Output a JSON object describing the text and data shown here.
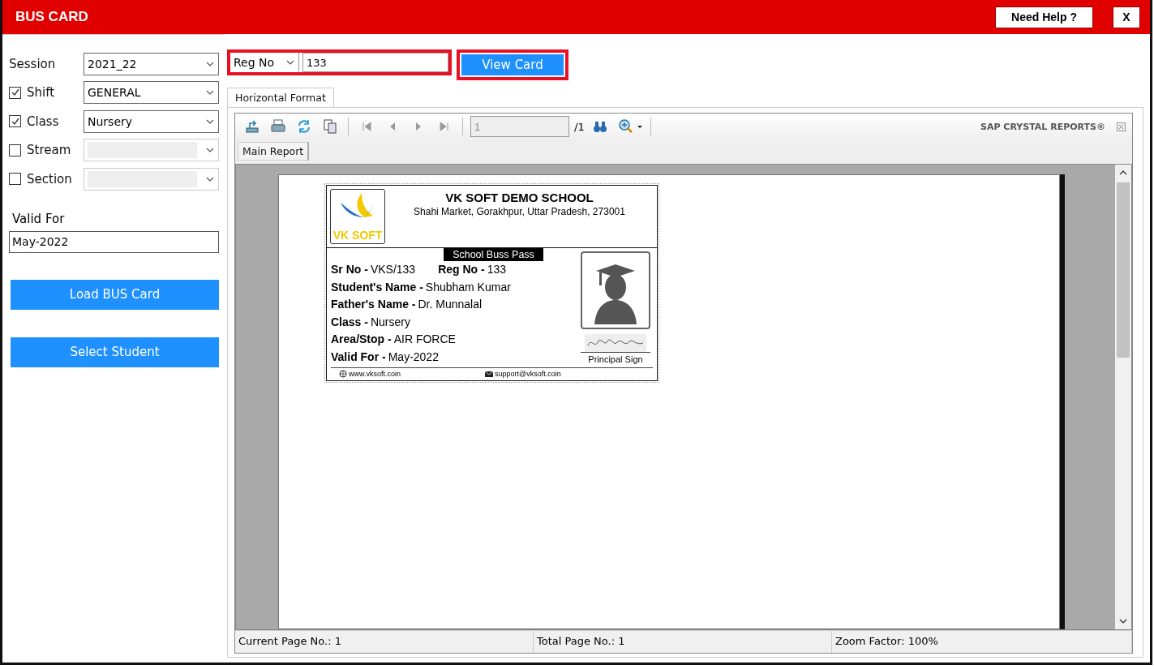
{
  "window": {
    "title": "BUS CARD",
    "buttons": [
      "Need Help ?",
      "X"
    ]
  },
  "filters": [
    {
      "kind": "plain",
      "label": "Session",
      "value": "2021_22",
      "disabled": false
    },
    {
      "kind": "check",
      "label": "Shift",
      "checked": true,
      "value": "GENERAL",
      "disabled": false
    },
    {
      "kind": "check",
      "label": "Class",
      "checked": true,
      "value": "Nursery",
      "disabled": false
    },
    {
      "kind": "check",
      "label": "Stream",
      "checked": false,
      "disabled": true
    },
    {
      "kind": "check",
      "label": "Section",
      "checked": false,
      "disabled": true
    }
  ],
  "valid_for": {
    "label": "Valid For",
    "value": "May-2022"
  },
  "side_buttons": [
    "Load BUS Card",
    "Select Student"
  ],
  "search": {
    "field": "Reg No",
    "value": "133",
    "button": "View Card"
  },
  "tabs": [
    {
      "label": "Horizontal Format",
      "selected": true
    }
  ],
  "viewer": {
    "page": "1",
    "page_total": "/1",
    "brand": "SAP CRYSTAL REPORTS®",
    "report_tabs": [
      {
        "label": "Main Report",
        "selected": true
      }
    ],
    "card": {
      "school": "VK SOFT DEMO SCHOOL",
      "address": "Shahi Market, Gorakhpur, Uttar Pradesh, 273001",
      "logo_text": "VK SOFT",
      "pass_title": "School Buss Pass",
      "rows": [
        [
          {
            "label": "Sr No -",
            "value": "VKS/133"
          },
          {
            "label": "Reg No -",
            "value": "133"
          }
        ],
        [
          {
            "label": "Student's Name -",
            "value": "Shubham Kumar"
          }
        ],
        [
          {
            "label": "Father's Name -",
            "value": "Dr. Munnalal"
          }
        ],
        [
          {
            "label": "Class -",
            "value": "Nursery"
          }
        ],
        [
          {
            "label": "Area/Stop -",
            "value": "AIR FORCE"
          }
        ],
        [
          {
            "label": "Valid For -",
            "value": "May-2022"
          }
        ]
      ],
      "sign_label": "Principal Sign",
      "website": "www.vksoft.coin",
      "email": "support@vksoft.coin"
    },
    "status_bar": [
      "Current Page No.: 1",
      "Total Page No.: 1",
      "Zoom Factor: 100%"
    ]
  }
}
